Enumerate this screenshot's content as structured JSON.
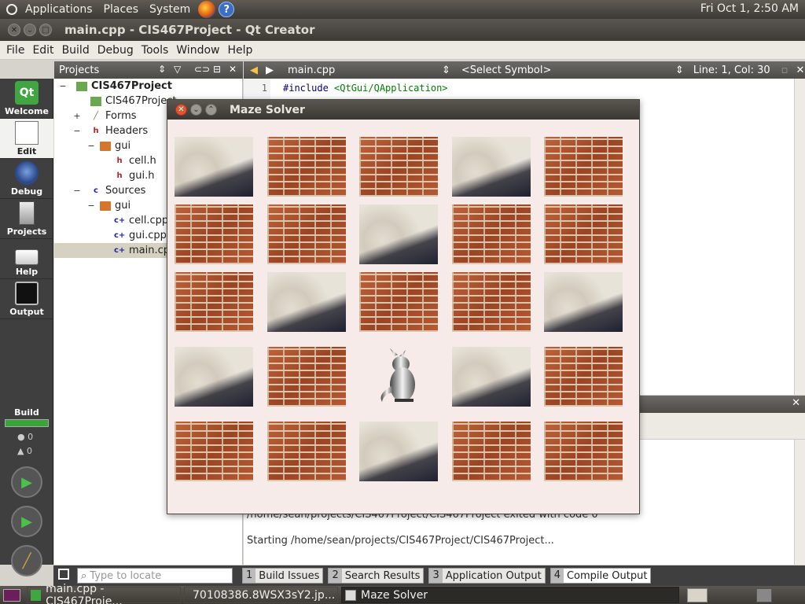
{
  "top_panel": {
    "menus": [
      "Applications",
      "Places",
      "System"
    ],
    "clock": "Fri Oct  1,  2:50 AM"
  },
  "main_window": {
    "title": "main.cpp - CIS467Project - Qt Creator"
  },
  "menubar": [
    "File",
    "Edit",
    "Build",
    "Debug",
    "Tools",
    "Window",
    "Help"
  ],
  "modes": [
    "Welcome",
    "Edit",
    "Debug",
    "Projects",
    "Help",
    "Output"
  ],
  "build_label": "Build",
  "counts": {
    "errors": "0",
    "warnings": "0"
  },
  "projects_pane": {
    "title": "Projects",
    "tree": [
      {
        "label": "CIS467Project",
        "bold": true
      },
      {
        "label": "CIS467Project"
      },
      {
        "label": "Forms"
      },
      {
        "label": "Headers"
      },
      {
        "label": "gui"
      },
      {
        "label": "cell.h"
      },
      {
        "label": "gui.h"
      },
      {
        "label": "Sources"
      },
      {
        "label": "gui"
      },
      {
        "label": "cell.cpp"
      },
      {
        "label": "gui.cpp"
      },
      {
        "label": "main.cpp"
      }
    ]
  },
  "editor": {
    "file": "main.cpp",
    "symbol": "<Select Symbol>",
    "position": "Line: 1, Col: 30",
    "line_number": "1",
    "code_line1": "#include ",
    "code_line1_path": "<QtGui/QApplication>"
  },
  "output": {
    "line1": "/home/sean/projects/CIS467Project/CIS467Project exited with code 0",
    "line2": "Starting /home/sean/projects/CIS467Project/CIS467Project..."
  },
  "locator_placeholder": "Type to locate",
  "bottom_tabs": [
    {
      "num": "1",
      "label": "Build Issues"
    },
    {
      "num": "2",
      "label": "Search Results"
    },
    {
      "num": "3",
      "label": "Application Output"
    },
    {
      "num": "4",
      "label": "Compile Output"
    }
  ],
  "taskbar": [
    "main.cpp - CIS467Proje...",
    "70108386.8WSX3sY2.jp...",
    "Maze Solver"
  ],
  "maze_window": {
    "title": "Maze Solver",
    "grid": [
      [
        "sand",
        "brick",
        "brick",
        "sand",
        "brick"
      ],
      [
        "brick",
        "brick",
        "sand",
        "brick",
        "brick"
      ],
      [
        "brick",
        "sand",
        "brick",
        "brick",
        "sand"
      ],
      [
        "sand",
        "brick",
        "mouse",
        "sand",
        "brick"
      ],
      [
        "brick",
        "brick",
        "sand",
        "brick",
        "brick"
      ]
    ]
  }
}
